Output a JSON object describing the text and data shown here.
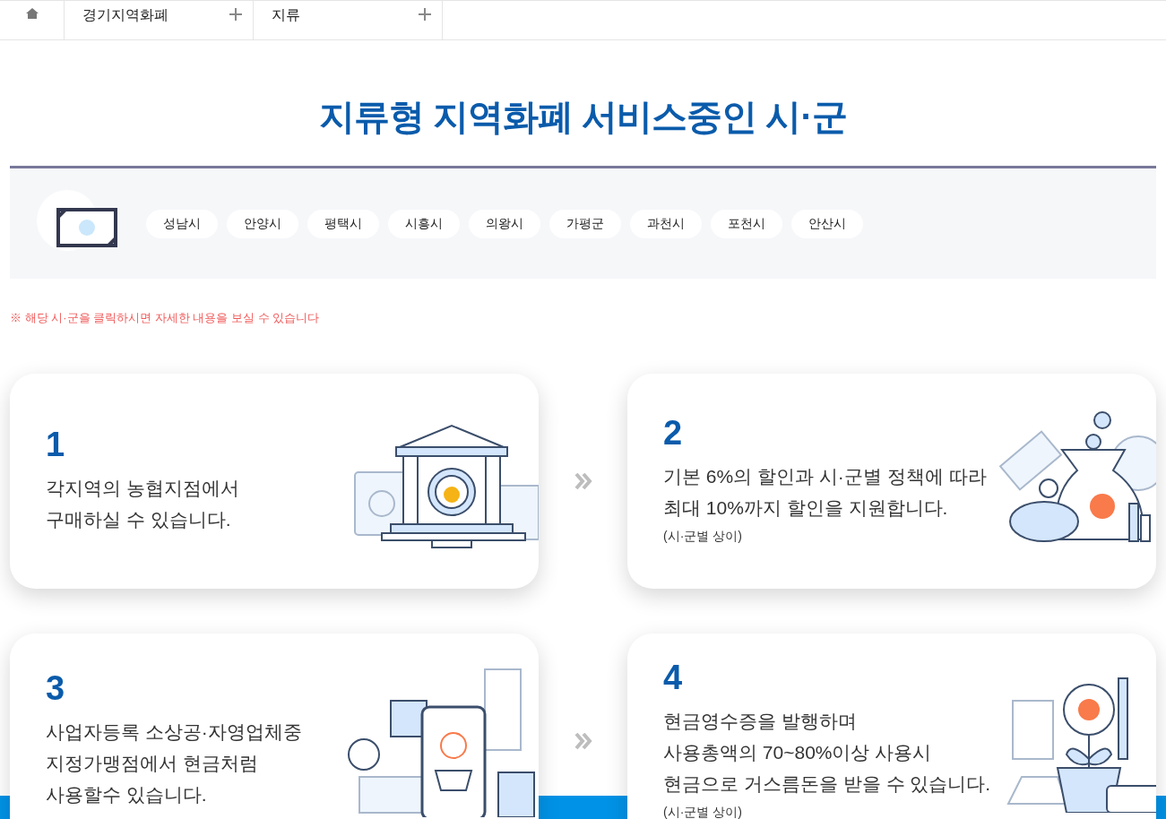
{
  "breadcrumb": {
    "items": [
      {
        "label": "경기지역화폐"
      },
      {
        "label": "지류"
      }
    ]
  },
  "title": "지류형 지역화폐 서비스중인 시·군",
  "cities": [
    "성남시",
    "안양시",
    "평택시",
    "시흥시",
    "의왕시",
    "가평군",
    "과천시",
    "포천시",
    "안산시"
  ],
  "notice": "※ 해당 시·군을 클릭하시면 자세한 내용을 보실 수 있습니다",
  "steps": [
    {
      "number": "1",
      "lines": [
        "각지역의 농협지점에서",
        "구매하실 수 있습니다."
      ],
      "kind": "bank"
    },
    {
      "number": "2",
      "lines": [
        "기본 6%의 할인과 시·군별 정책에 따라",
        "최대 10%까지 할인을 지원합니다."
      ],
      "note": "(시·군별 상이)",
      "kind": "savings"
    },
    {
      "number": "3",
      "lines": [
        "사업자등록 소상공·자영업체중",
        "지정가맹점에서 현금처럼",
        "사용할수 있습니다."
      ],
      "kind": "shopping"
    },
    {
      "number": "4",
      "lines": [
        "현금영수증을 발행하며",
        "사용총액의 70~80%이상 사용시",
        "현금으로 거스름돈을 받을 수 있습니다."
      ],
      "note": "(시·군별 상이)",
      "kind": "growth"
    }
  ]
}
